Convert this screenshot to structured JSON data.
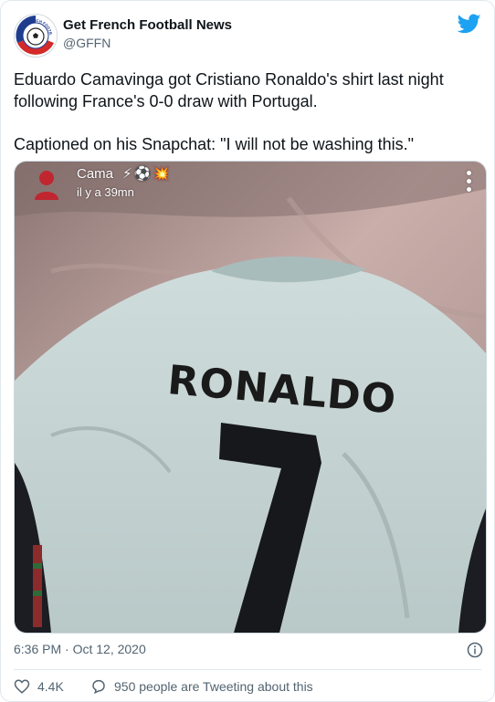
{
  "account": {
    "display_name": "Get French Football News",
    "handle": "@GFFN",
    "avatar_icon": "gffn-logo-avatar",
    "avatar_ring_text": "GET FRENCH FOOTBALL NEWS"
  },
  "platform_icon": "twitter-bird-icon",
  "tweet": {
    "paragraph_1": "Eduardo Camavinga got Cristiano Ronaldo's shirt last night following France's 0-0 draw with Portugal.",
    "paragraph_2": "Captioned on his Snapchat: \"I will not be washing this.\""
  },
  "media": {
    "snap_username": "Cama",
    "snap_emoji": "⚡⚽💥",
    "snap_time": "il y a 39mn",
    "shirt_name": "RONALDO",
    "shirt_number": "7",
    "description": "Photo of a Portugal away shirt with RONALDO 7 lying on a bed"
  },
  "footer": {
    "timestamp": "6:36 PM · Oct 12, 2020",
    "likes": "4.4K",
    "replies_text": "950 people are Tweeting about this"
  },
  "colors": {
    "twitter_blue": "#1da1f2",
    "text_primary": "#0f1419",
    "text_secondary": "#536471",
    "border": "#e1e8ed"
  }
}
